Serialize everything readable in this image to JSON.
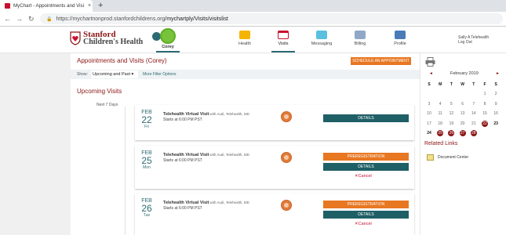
{
  "browser": {
    "tab_title": "MyChart - Appointments and Visi",
    "tab_close": "×",
    "new_tab": "+",
    "back": "←",
    "forward": "→",
    "reload": "↻",
    "url_host": "https://mychartnonprod.stanfordchildrens.org",
    "url_path": "/mychartply/Visits/visitslist"
  },
  "header": {
    "logo_line1": "Stanford",
    "logo_line2": "Children's Health",
    "proxy_name": "Corey",
    "nav": [
      {
        "label": "Health",
        "icon": "heart-icon",
        "color": "#f4b400"
      },
      {
        "label": "Visits",
        "icon": "calendar-icon",
        "color": "#c8102e"
      },
      {
        "label": "Messaging",
        "icon": "envelope-icon",
        "color": "#5bc0de"
      },
      {
        "label": "Billing",
        "icon": "credit-card-icon",
        "color": "#8fa8c8"
      },
      {
        "label": "Profile",
        "icon": "id-card-icon",
        "color": "#4a7bb7"
      }
    ],
    "user_name": "Sally A Telehealth",
    "logout": "Log Out"
  },
  "main": {
    "title": "Appointments and Visits (Corey)",
    "schedule_button": "SCHEDULE AN APPOINTMENT",
    "show_label": "Show:",
    "show_value": "Upcoming and Past",
    "more_filters": "More Filter Options",
    "upcoming_title": "Upcoming Visits",
    "next_7_days": "Next 7 Days",
    "cards": [
      {
        "month": "FEB",
        "day": "22",
        "dow": "Fri",
        "visit_type": "Telehealth Virtual Visit",
        "with": "with Audi, Telehealth, MD",
        "starts": "Starts at 6:00 PM PST",
        "prereg": "",
        "details": "DETAILS",
        "cancel": ""
      },
      {
        "month": "FEB",
        "day": "25",
        "dow": "Mon",
        "visit_type": "Telehealth Virtual Visit",
        "with": "with Audi, Telehealth, MD",
        "starts": "Starts at 6:00 PM PST",
        "prereg": "PREREGISTRATION",
        "details": "DETAILS",
        "cancel": "✕Cancel"
      },
      {
        "month": "FEB",
        "day": "26",
        "dow": "Tue",
        "visit_type": "Telehealth Virtual Visit",
        "with": "with Audi, Telehealth, MD",
        "starts": "Starts at 6:00 PM PST",
        "prereg": "PREREGISTRATION",
        "details": "DETAILS",
        "cancel": "✕Cancel"
      }
    ]
  },
  "sidebar": {
    "calendar": {
      "prev": "◄",
      "next": "►",
      "month": "February 2019",
      "dow": [
        "S",
        "M",
        "T",
        "W",
        "T",
        "F",
        "S"
      ],
      "weeks": [
        [
          "",
          "",
          "",
          "",
          "",
          "1",
          "2"
        ],
        [
          "3",
          "4",
          "5",
          "6",
          "7",
          "8",
          "9"
        ],
        [
          "10",
          "11",
          "12",
          "13",
          "14",
          "15",
          "16"
        ],
        [
          "17",
          "18",
          "19",
          "20",
          "21",
          "22",
          "23"
        ],
        [
          "24",
          "25",
          "26",
          "27",
          "28",
          "",
          ""
        ]
      ],
      "highlighted": [
        "22",
        "25",
        "26",
        "27",
        "28"
      ],
      "bold": [
        "23",
        "24"
      ]
    },
    "related_title": "Related Links",
    "related_links": [
      "Document Center"
    ]
  }
}
